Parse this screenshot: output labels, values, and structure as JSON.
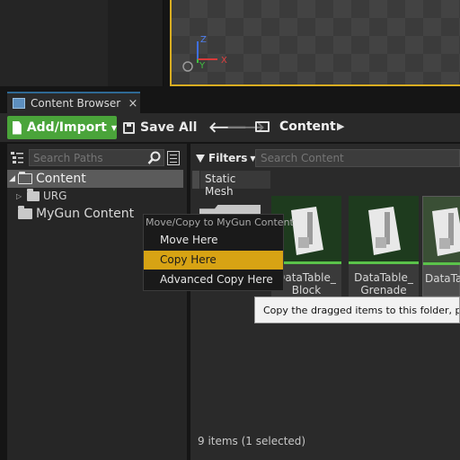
{
  "tab": {
    "label": "Content Browser",
    "close": "×"
  },
  "toolbar": {
    "add_import_label": "Add/Import",
    "save_all_label": "Save All",
    "breadcrumb": "Content"
  },
  "sources": {
    "search_placeholder": "Search Paths",
    "tree": [
      {
        "label": "Content",
        "expanded": true,
        "selected": true
      },
      {
        "label": "URG",
        "expanded": false
      },
      {
        "label": "MyGun Content"
      }
    ]
  },
  "assets": {
    "filters_label": "Filters",
    "search_placeholder": "Search Content",
    "active_filter": "Static Mesh",
    "items": [
      {
        "name": "DataTable_ Block"
      },
      {
        "name": "DataTable_ Grenade"
      },
      {
        "name": "DataTa",
        "selected": true
      }
    ],
    "status": "9 items (1 selected)"
  },
  "context_menu": {
    "heading": "Move/Copy to MyGun Content",
    "items": [
      "Move Here",
      "Copy Here",
      "Advanced Copy Here"
    ],
    "highlighted": "Copy Here"
  },
  "tooltip": "Copy the dragged items to this folder, preserving the structure",
  "colors": {
    "accent_green": "#4aa43a",
    "highlight": "#d7a314",
    "viewport_border": "#d9ad21",
    "tab_accent": "#2f6a95"
  }
}
